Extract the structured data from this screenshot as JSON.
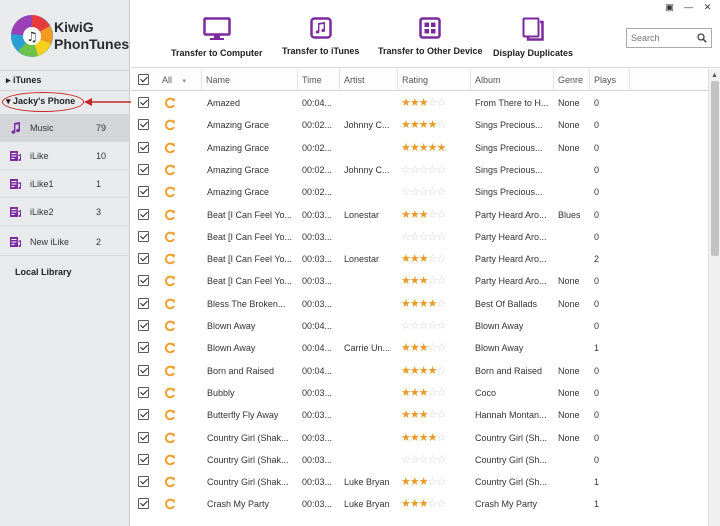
{
  "app": {
    "name_line1": "KiwiG",
    "name_line2": "PhonTunes"
  },
  "window_controls": [
    "restore-icon",
    "minimize-icon",
    "close-icon"
  ],
  "sidebar": {
    "itunes_label": "iTunes",
    "phone_label": "Jacky's Phone",
    "items": [
      {
        "label": "Music",
        "count": "79",
        "icon": "music-note-icon"
      },
      {
        "label": "iLike",
        "count": "10",
        "icon": "playlist-icon"
      },
      {
        "label": "iLike1",
        "count": "1",
        "icon": "playlist-icon"
      },
      {
        "label": "iLike2",
        "count": "3",
        "icon": "playlist-icon"
      },
      {
        "label": "New iLike",
        "count": "2",
        "icon": "playlist-icon"
      }
    ],
    "local_library_label": "Local Library"
  },
  "toolbar": {
    "transfer_computer": "Transfer to Computer",
    "transfer_itunes": "Transfer to iTunes",
    "transfer_device": "Transfer to Other Device",
    "display_duplicates": "Display Duplicates",
    "search_placeholder": "Search"
  },
  "colors": {
    "accent": "#7b2a9e",
    "star": "#e89a2a",
    "annotation": "#c62828",
    "sync": "#f0a030"
  },
  "table": {
    "headers": {
      "all": "All",
      "name": "Name",
      "time": "Time",
      "artist": "Artist",
      "rating": "Rating",
      "album": "Album",
      "genre": "Genre",
      "plays": "Plays"
    },
    "rows": [
      {
        "name": "Amazed",
        "time": "00:04...",
        "artist": "",
        "rating": 3,
        "album": "From There to H...",
        "genre": "None",
        "plays": "0"
      },
      {
        "name": "Amazing Grace",
        "time": "00:02...",
        "artist": "Johnny C...",
        "rating": 4,
        "album": "Sings Precious...",
        "genre": "None",
        "plays": "0"
      },
      {
        "name": "Amazing Grace",
        "time": "00:02...",
        "artist": "",
        "rating": 5,
        "album": "Sings Precious...",
        "genre": "None",
        "plays": "0"
      },
      {
        "name": "Amazing Grace",
        "time": "00:02...",
        "artist": "Johnny C...",
        "rating": 0,
        "album": "Sings Precious...",
        "genre": "",
        "plays": "0"
      },
      {
        "name": "Amazing Grace",
        "time": "00:02...",
        "artist": "",
        "rating": 0,
        "album": "Sings Precious...",
        "genre": "",
        "plays": "0"
      },
      {
        "name": "Beat [I Can Feel Yo...",
        "time": "00:03...",
        "artist": "Lonestar",
        "rating": 3,
        "album": "Party Heard Aro...",
        "genre": "Blues",
        "plays": "0"
      },
      {
        "name": "Beat [I Can Feel Yo...",
        "time": "00:03...",
        "artist": "",
        "rating": 0,
        "album": "Party Heard Aro...",
        "genre": "",
        "plays": "0"
      },
      {
        "name": "Beat [I Can Feel Yo...",
        "time": "00:03...",
        "artist": "Lonestar",
        "rating": 3,
        "album": "Party Heard Aro...",
        "genre": "",
        "plays": "2"
      },
      {
        "name": "Beat [I Can Feel Yo...",
        "time": "00:03...",
        "artist": "",
        "rating": 3,
        "album": "Party Heard Aro...",
        "genre": "None",
        "plays": "0"
      },
      {
        "name": "Bless The Broken...",
        "time": "00:03...",
        "artist": "",
        "rating": 4,
        "album": "Best Of Ballads",
        "genre": "None",
        "plays": "0"
      },
      {
        "name": "Blown Away",
        "time": "00:04...",
        "artist": "",
        "rating": 0,
        "album": "Blown Away",
        "genre": "",
        "plays": "0"
      },
      {
        "name": "Blown Away",
        "time": "00:04...",
        "artist": "Carrie Un...",
        "rating": 3,
        "album": "Blown Away",
        "genre": "",
        "plays": "1"
      },
      {
        "name": "Born and Raised",
        "time": "00:04...",
        "artist": "",
        "rating": 4,
        "album": "Born and Raised",
        "genre": "None",
        "plays": "0"
      },
      {
        "name": "Bubbly",
        "time": "00:03...",
        "artist": "",
        "rating": 3,
        "album": "Coco",
        "genre": "None",
        "plays": "0"
      },
      {
        "name": "Butterfly Fly Away",
        "time": "00:03...",
        "artist": "",
        "rating": 3,
        "album": "Hannah Montan...",
        "genre": "None",
        "plays": "0"
      },
      {
        "name": "Country Girl (Shak...",
        "time": "00:03...",
        "artist": "",
        "rating": 4,
        "album": "Country Girl (Sh...",
        "genre": "None",
        "plays": "0"
      },
      {
        "name": "Country Girl (Shak...",
        "time": "00:03...",
        "artist": "",
        "rating": 0,
        "album": "Country Girl (Sh...",
        "genre": "",
        "plays": "0"
      },
      {
        "name": "Country Girl (Shak...",
        "time": "00:03...",
        "artist": "Luke Bryan",
        "rating": 3,
        "album": "Country Girl (Sh...",
        "genre": "",
        "plays": "1"
      },
      {
        "name": "Crash My Party",
        "time": "00:03...",
        "artist": "Luke Bryan",
        "rating": 3,
        "album": "Crash My Party",
        "genre": "",
        "plays": "1"
      }
    ]
  }
}
